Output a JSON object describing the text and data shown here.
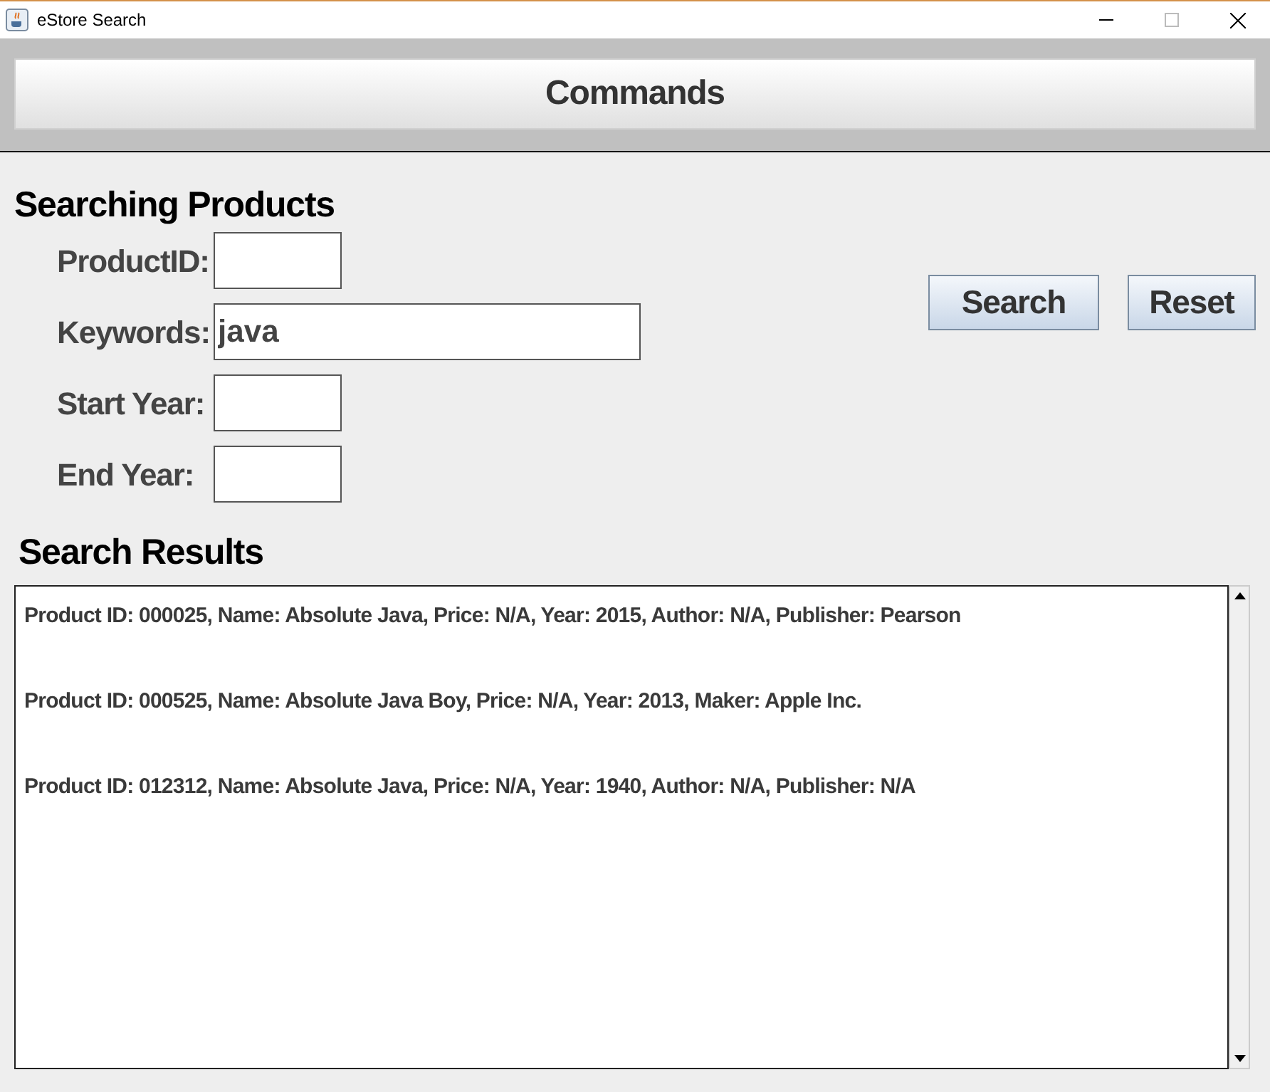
{
  "window": {
    "title": "eStore Search"
  },
  "commands_button": "Commands",
  "search_section": {
    "title": "Searching Products",
    "fields": [
      {
        "label": "ProductID:",
        "kind": "short"
      },
      {
        "label": "Keywords:",
        "value": "java",
        "kind": "long"
      },
      {
        "label": "Start Year:",
        "kind": "short"
      },
      {
        "label": "End Year:",
        "kind": "short"
      }
    ],
    "buttons": [
      "Search",
      "Reset"
    ]
  },
  "results_section": {
    "title": "Search Results",
    "lines": [
      "Product ID: 000025, Name: Absolute Java, Price: N/A, Year: 2015, Author: N/A, Publisher: Pearson",
      "Product ID: 000525, Name: Absolute Java Boy, Price: N/A, Year: 2013, Maker: Apple Inc.",
      "Product ID: 012312, Name: Absolute Java, Price: N/A, Year: 1940, Author: N/A, Publisher: N/A"
    ]
  }
}
